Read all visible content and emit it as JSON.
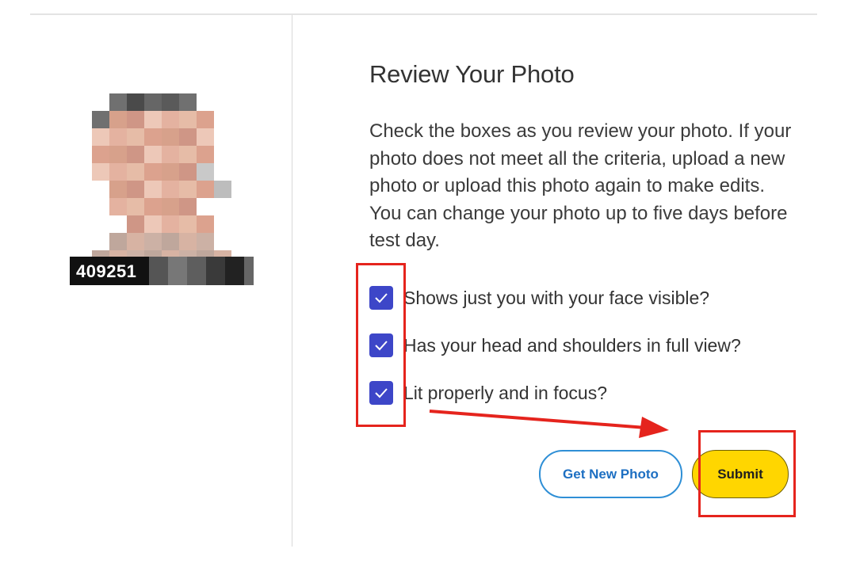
{
  "photo": {
    "id_text": "409251"
  },
  "review": {
    "title": "Review Your Photo",
    "instructions": "Check the boxes as you review your photo. If your photo does not meet all the criteria, upload a new photo or upload this photo again to make edits. You can change your photo up to five days before test day."
  },
  "criteria": [
    {
      "label": "Shows just you with your face visible?",
      "checked": true
    },
    {
      "label": "Has your head and shoulders in full view?",
      "checked": true
    },
    {
      "label": "Lit properly and in focus?",
      "checked": true
    }
  ],
  "buttons": {
    "get_new_photo": "Get New Photo",
    "submit": "Submit"
  },
  "icons": {
    "checkbox": "checkmark-icon"
  },
  "colors": {
    "checkbox": "#3d46c8",
    "primary_button": "#ffd600",
    "secondary_border": "#2f8fd6",
    "annotation": "#e5241d"
  }
}
